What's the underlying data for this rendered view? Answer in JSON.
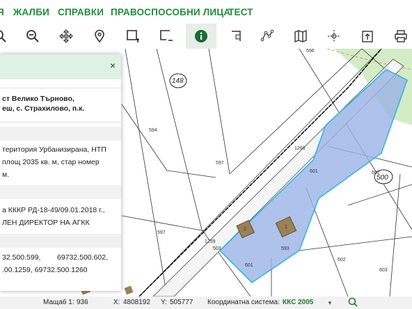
{
  "nav": {
    "item1": "Я",
    "item2": "ЖАЛБИ",
    "item3": "СПРАВКИ",
    "item4": "ПРАВОСПОСОБНИ ЛИЦА",
    "item5": "ТЕСТ"
  },
  "toolbar": {
    "tools": [
      "zoom-in",
      "zoom-out",
      "pan",
      "locate",
      "select-rectangle",
      "clear-selection",
      "info",
      "measure-area",
      "measure-line",
      "map-layers",
      "crosshair",
      "export",
      "print"
    ],
    "active": "info"
  },
  "popup": {
    "close_label": "×",
    "line1": "ст Велико Търново,",
    "line2": "еш, с. Страхилово, п.к.",
    "line3": "територия Урбанизирана, НТП",
    "line4": "площ 2035 кв. м, стар номер",
    "line5": "м.",
    "line6": "а КККР РД-18-49/09.01.2018 г.,",
    "line7": "ЛЕН ДИРЕКТОР НА АГКК",
    "line8a": "32.500.599,",
    "line8b": "69732.500.602,",
    "line9": ".00.1259, 69732.500.1260"
  },
  "map": {
    "block_label_148": "148",
    "block_label_500": "500",
    "parcels": [
      "596",
      "594",
      "597",
      "1260",
      "601",
      "602",
      "597",
      "1259",
      "593",
      "601",
      "602",
      "603",
      "503"
    ],
    "building_labels": [
      "1",
      "2"
    ],
    "selection_color": "#9bb3e6",
    "selection_border": "#2fb7e0"
  },
  "status": {
    "scale_label": "Мащаб 1:",
    "scale_value": "936",
    "x_label": "X:",
    "x_value": "4808192",
    "y_label": "Y:",
    "y_value": "505777",
    "crs_label": "Координатна система:",
    "crs_value": "ККС 2005"
  }
}
